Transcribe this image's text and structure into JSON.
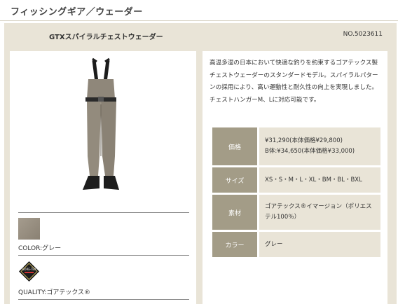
{
  "breadcrumb": "フィッシングギア／ウェーダー",
  "product": {
    "name": "GTXスパイラルチェストウェーダー",
    "number": "NO.5023611",
    "description": "高温多湿の日本において快適な釣りを約束するゴアテックス製チェストウェーダーのスタンダードモデル。スパイラルパターンの採用により、高い運動性と耐久性の向上を実現しました。チェストハンガーM、Lに対応可能です。"
  },
  "specs": [
    {
      "label": "価格",
      "lines": [
        "¥31,290(本体価格¥29,800)",
        "B体:¥34,650(本体価格¥33,000)"
      ]
    },
    {
      "label": "サイズ",
      "lines": [
        "XS・S・M・L・XL・BM・BL・BXL"
      ]
    },
    {
      "label": "素材",
      "lines": [
        "ゴアテックス®イマージョン（ポリエステル100％）"
      ]
    },
    {
      "label": "カラー",
      "lines": [
        "グレー"
      ]
    }
  ],
  "color": {
    "text": "COLOR:グレー",
    "swatch": "#9a9183"
  },
  "quality": {
    "text": "QUALITY:ゴアテックス®",
    "logo_text": "GORE-TEX"
  },
  "colors": {
    "panel": "#e9e4d7",
    "label_bg": "#a39c87"
  }
}
